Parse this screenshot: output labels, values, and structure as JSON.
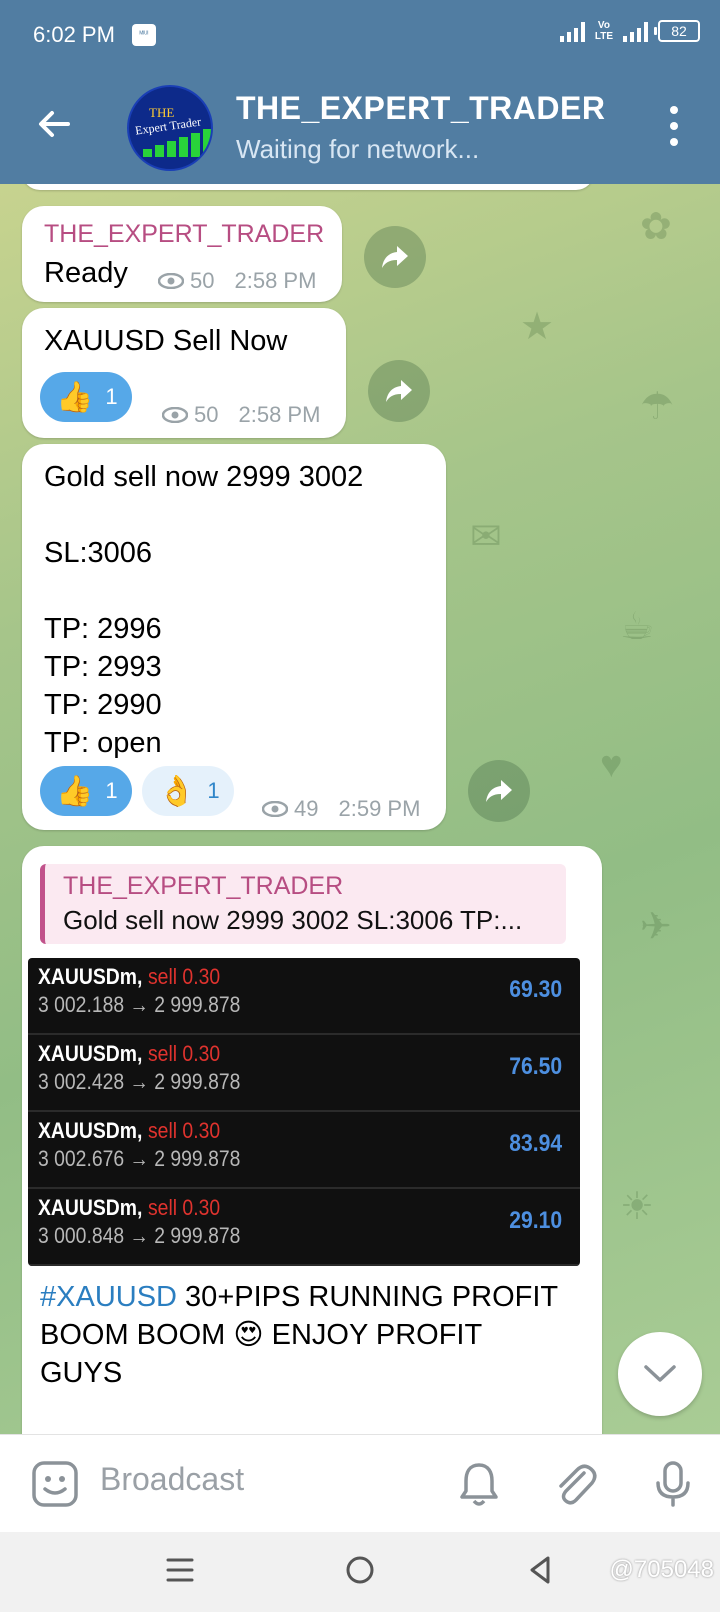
{
  "status": {
    "time": "6:02 PM",
    "notif_label": "ᴹᴵᵁᴵ",
    "volte_top": "Vo",
    "volte_bottom": "LTE",
    "battery": "82"
  },
  "header": {
    "title": "THE_EXPERT_TRADER",
    "subtitle": "Waiting for network...",
    "avatar_line1": "THE",
    "avatar_line2": "Expert Trader"
  },
  "messages": [
    {
      "sender": "THE_EXPERT_TRADER",
      "text": "Ready",
      "views": "50",
      "time": "2:58 PM"
    },
    {
      "text": "XAUUSD Sell Now",
      "reactions": [
        {
          "emoji": "👍",
          "count": "1"
        }
      ],
      "views": "50",
      "time": "2:58 PM"
    },
    {
      "text": "Gold sell now 2999 3002\n\nSL:3006\n\nTP: 2996\nTP: 2993\nTP: 2990\nTP: open",
      "reactions": [
        {
          "emoji": "👍",
          "count": "1"
        },
        {
          "emoji": "👌",
          "count": "1"
        }
      ],
      "views": "49",
      "time": "2:59 PM"
    },
    {
      "quote_sender": "THE_EXPERT_TRADER",
      "quote_text": "Gold sell now 2999 3002  SL:3006  TP:...",
      "trades": [
        {
          "symbol": "XAUUSDm,",
          "side": "sell 0.30",
          "prices": "3 002.188 → 2 999.878",
          "pnl": "69.30"
        },
        {
          "symbol": "XAUUSDm,",
          "side": "sell 0.30",
          "prices": "3 002.428 → 2 999.878",
          "pnl": "76.50"
        },
        {
          "symbol": "XAUUSDm,",
          "side": "sell 0.30",
          "prices": "3 002.676 → 2 999.878",
          "pnl": "83.94"
        },
        {
          "symbol": "XAUUSDm,",
          "side": "sell 0.30",
          "prices": "3 000.848 → 2 999.878",
          "pnl": "29.10"
        }
      ],
      "caption_tag": "#XAUUSD",
      "caption_text": " 30+PIPS RUNNING PROFIT BOOM BOOM 😍 ENJOY PROFIT GUYS"
    }
  ],
  "composer": {
    "placeholder": "Broadcast"
  },
  "watermark": "@705048"
}
